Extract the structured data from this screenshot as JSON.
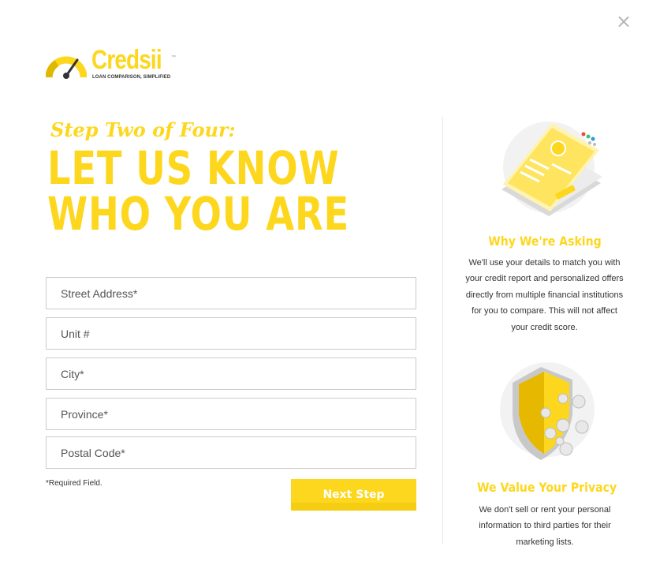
{
  "close_label": "×",
  "logo": {
    "wordmark": "Credsii",
    "trademark": "™",
    "tagline": "LOAN COMPARISON, SIMPLIFIED"
  },
  "form": {
    "step_label": "Step Two of Four:",
    "headline_line1": "LET US KNOW",
    "headline_line2": "WHO YOU ARE",
    "fields": {
      "street_address": {
        "placeholder": "Street Address*",
        "value": ""
      },
      "unit": {
        "placeholder": "Unit #",
        "value": ""
      },
      "city": {
        "placeholder": "City*",
        "value": ""
      },
      "province": {
        "placeholder": "Province*",
        "value": ""
      },
      "postal_code": {
        "placeholder": "Postal Code*",
        "value": ""
      }
    },
    "required_note": "*Required Field.",
    "next_button": "Next Step"
  },
  "info": [
    {
      "icon": "credit-form-illustration",
      "title": "Why We're Asking",
      "text": "We'll use your details to match you with your credit report and personalized offers directly from multiple financial institutions for you to compare. This will not affect your credit score."
    },
    {
      "icon": "privacy-shield-illustration",
      "title": "We Value Your Privacy",
      "text": "We don't sell or rent your personal information to third parties for their marketing lists."
    }
  ],
  "colors": {
    "accent": "#fdd71e",
    "text": "#333333",
    "border": "#cccccc",
    "close": "#b5b5b5"
  }
}
